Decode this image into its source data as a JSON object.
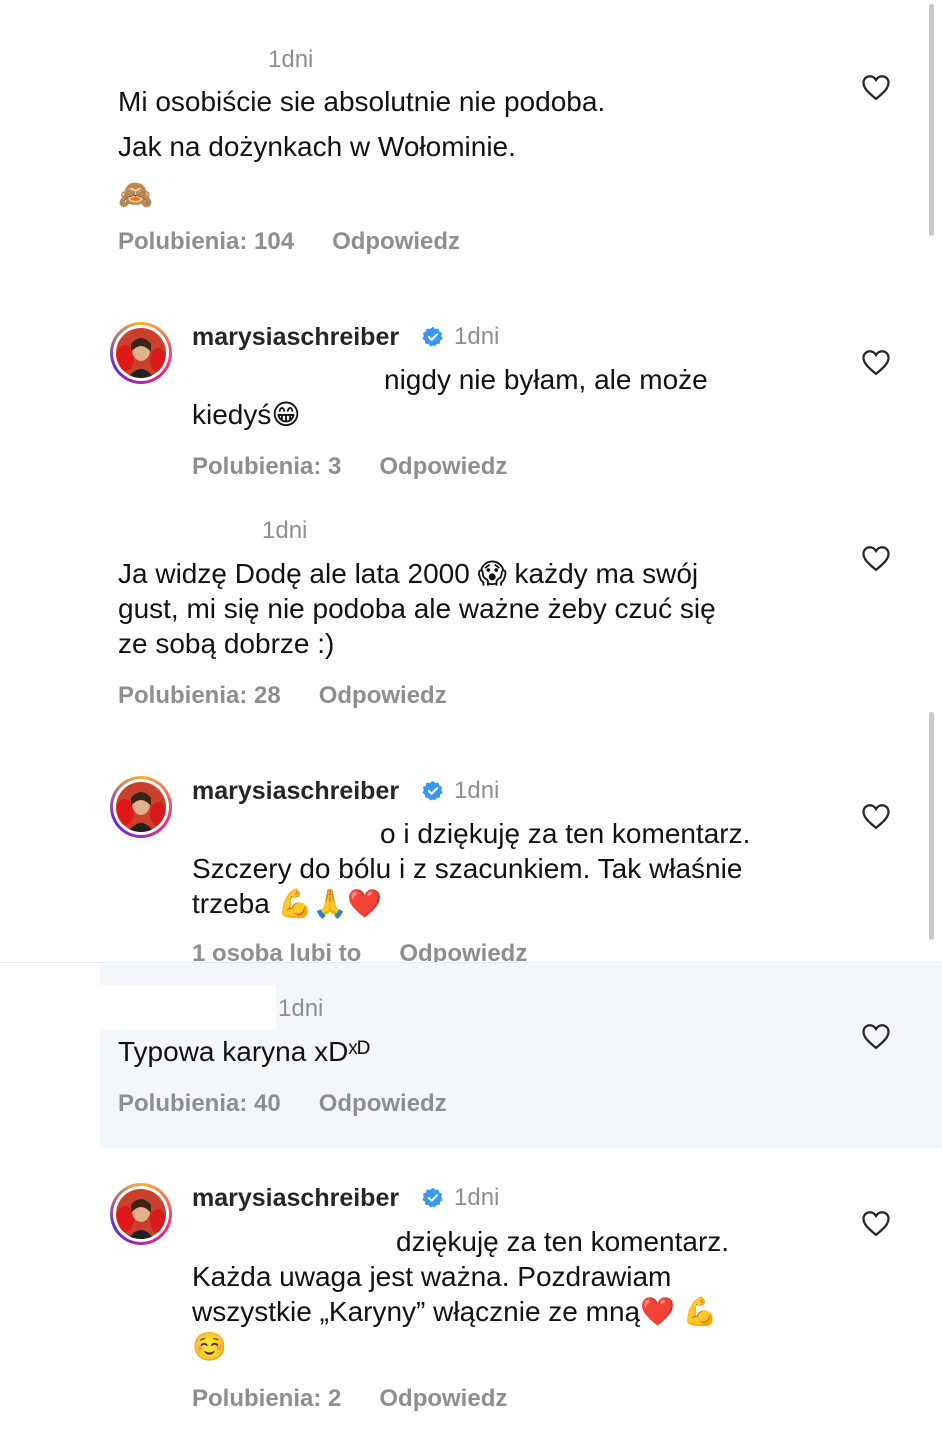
{
  "comments": [
    {
      "time": "1dni",
      "lines": [
        "Mi osobiście sie absolutnie nie podoba.",
        "Jak na dożynkach w Wołominie."
      ],
      "emoji": "🙈",
      "likes": "Polubienia: 104",
      "reply": "Odpowiedz"
    },
    {
      "username": "marysiaschreiber",
      "time": "1dni",
      "lines": [
        "nigdy nie byłam, ale może",
        "kiedyś😁"
      ],
      "likes": "Polubienia: 3",
      "reply": "Odpowiedz"
    },
    {
      "time": "1dni",
      "lines": [
        "Ja widzę Dodę ale lata 2000 😱 każdy ma swój",
        "gust, mi się nie podoba ale ważne żeby czuć się",
        "ze sobą dobrze :)"
      ],
      "likes": "Polubienia: 28",
      "reply": "Odpowiedz"
    },
    {
      "username": "marysiaschreiber",
      "time": "1dni",
      "lines": [
        "o i dziękuję za ten komentarz.",
        "Szczery do bólu i z szacunkiem. Tak właśnie",
        "trzeba 💪🙏❤️"
      ],
      "likes": "1 osoba lubi to",
      "reply": "Odpowiedz"
    },
    {
      "time": "1dni",
      "lines": [
        "Typowa karyna xDˣᴰ"
      ],
      "likes": "Polubienia: 40",
      "reply": "Odpowiedz"
    },
    {
      "username": "marysiaschreiber",
      "time": "1dni",
      "lines": [
        "dziękuję za ten komentarz.",
        "Każda uwaga jest ważna. Pozdrawiam",
        "wszystkie „Karyny” włącznie ze mną❤️ 💪",
        "☺️"
      ],
      "likes": "Polubienia: 2",
      "reply": "Odpowiedz"
    }
  ],
  "icons": {
    "heart": "heart-outline-icon",
    "verified": "verified-badge-icon"
  },
  "colors": {
    "verified": "#3897f0",
    "meta": "#8e8e8e",
    "highlight": "#f3f7fb"
  }
}
